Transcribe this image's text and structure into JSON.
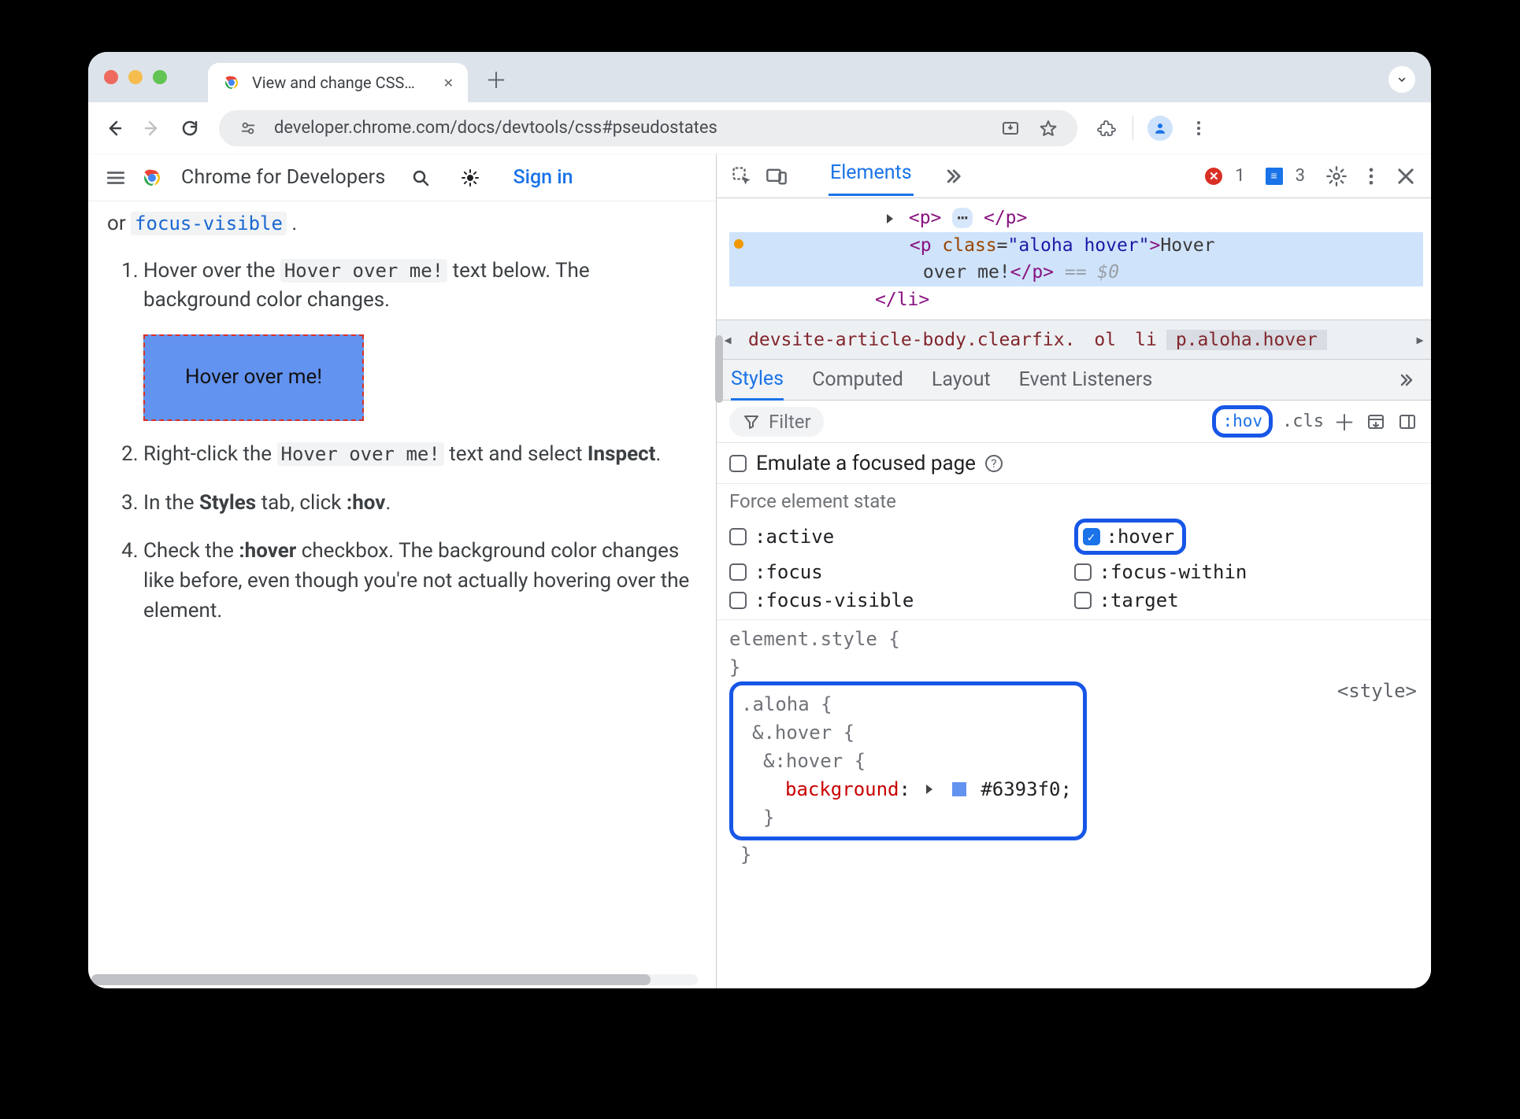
{
  "browser": {
    "tab_title": "View and change CSS  |  Chrome",
    "url": "developer.chrome.com/docs/devtools/css#pseudostates"
  },
  "page_header": {
    "site_title": "Chrome for Developers",
    "sign_in": "Sign in"
  },
  "article": {
    "or": "or ",
    "focus_visible": "focus-visible",
    "period": " .",
    "steps": {
      "s1_a": "Hover over the ",
      "s1_code": "Hover over me!",
      "s1_b": " text below. The background color changes.",
      "demo": "Hover over me!",
      "s2_a": "Right-click the ",
      "s2_code": "Hover over me!",
      "s2_b": " text and select ",
      "inspect": "Inspect",
      "s2_c": ".",
      "s3_a": "In the ",
      "styles": "Styles",
      "s3_b": " tab, click ",
      "hov": ":hov",
      "s3_c": ".",
      "s4_a": "Check the ",
      "hover": ":hover",
      "s4_b": " checkbox. The background color changes like before, even though you're not actually hovering over the element."
    }
  },
  "devtools": {
    "top": {
      "elements": "Elements",
      "errors": "1",
      "info": "3"
    },
    "dom": {
      "row1": {
        "open": "<p>",
        "mid": "⋯",
        "close": "</p>"
      },
      "row2": {
        "open": "<p ",
        "attr": "class",
        "eq": "=",
        "val": "\"aloha hover\"",
        "close": ">",
        "text": "Hover "
      },
      "row3": {
        "text": "over me!",
        "close": "</p>",
        "eq": " == ",
        "ref": "$0"
      },
      "row4": {
        "close": "</li>"
      }
    },
    "breadcrumb": {
      "c1": "devsite-article-body.clearfix.",
      "c2": "ol",
      "c3": "li",
      "c4": "p.aloha.hover"
    },
    "styles_tabs": {
      "styles": "Styles",
      "computed": "Computed",
      "layout": "Layout",
      "events": "Event Listeners"
    },
    "filterbar": {
      "placeholder": "Filter",
      "hov": ":hov",
      "cls": ".cls"
    },
    "emulate": "Emulate a focused page",
    "force": {
      "label": "Force element state",
      "active": ":active",
      "hover": ":hover",
      "focus": ":focus",
      "focus_within": ":focus-within",
      "focus_visible": ":focus-visible",
      "target": ":target"
    },
    "rules": {
      "el": "element.style {",
      "elc": "}",
      "aloha": ".aloha {",
      "amp_hover": "&.hover {",
      "amp_pseudo": "&:hover {",
      "prop": "background",
      "colon": ": ",
      "val": "#6393f0;",
      "cb": "}",
      "origin": "<style>"
    }
  }
}
